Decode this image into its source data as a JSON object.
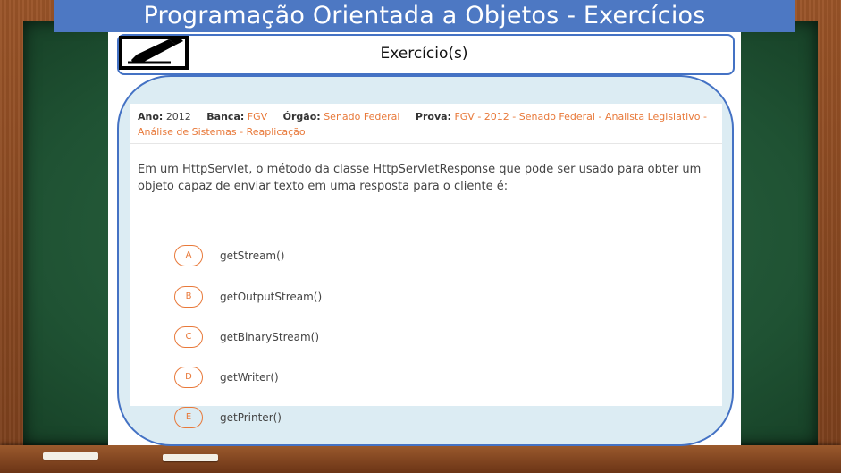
{
  "title": "Programação Orientada a Objetos - Exercícios",
  "header": {
    "icon": "pencil-edit-icon",
    "label": "Exercício(s)"
  },
  "question": {
    "ano_label": "Ano:",
    "ano": "2012",
    "banca_label": "Banca:",
    "banca": "FGV",
    "orgao_label": "Órgão:",
    "orgao": "Senado Federal",
    "prova_label": "Prova:",
    "prova": "FGV - 2012 - Senado Federal - Analista Legislativo - Análise de Sistemas - Reaplicação",
    "statement": "Em um HttpServlet, o método da classe HttpServletResponse que pode ser usado para obter um objeto capaz de enviar texto em uma resposta para o cliente é:",
    "options": [
      {
        "letter": "A",
        "text": "getStream()"
      },
      {
        "letter": "B",
        "text": "getOutputStream()"
      },
      {
        "letter": "C",
        "text": "getBinaryStream()"
      },
      {
        "letter": "D",
        "text": "getWriter()"
      },
      {
        "letter": "E",
        "text": "getPrinter()"
      }
    ]
  },
  "colors": {
    "accent_orange": "#e8793a",
    "frame_blue": "#4472c4",
    "banner_blue": "#4d78c3",
    "chalkboard_green": "#1f5233"
  }
}
